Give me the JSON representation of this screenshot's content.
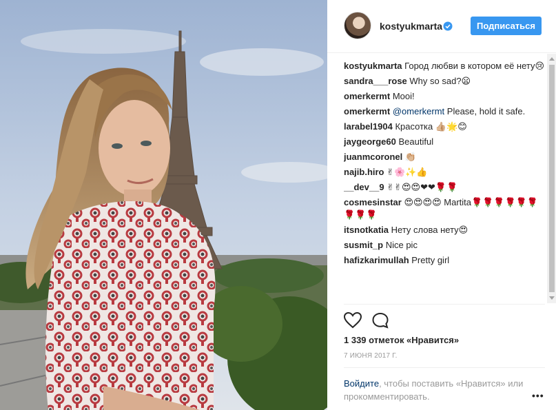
{
  "post": {
    "author": "kostyukmarta",
    "follow_label": "Подписаться",
    "likes": "1 339 отметок «Нравится»",
    "date": "7 июня 2017 г."
  },
  "comments": [
    {
      "author": "kostyukmarta",
      "text": "Город любви в котором её нету😢"
    },
    {
      "author": "sandra___rose",
      "text": "Why so sad?😦"
    },
    {
      "author": "omerkermt",
      "text": "Mooi!"
    },
    {
      "author": "omerkermt",
      "mention": "@omerkermt",
      "text": "Please, hold it safe."
    },
    {
      "author": "larabel1904",
      "text": "Красотка 👍🏼🌟😊"
    },
    {
      "author": "jaygeorge60",
      "text": "Beautiful"
    },
    {
      "author": "juanmcoronel",
      "text": "👏🏼"
    },
    {
      "author": "najib.hiro",
      "text": "✌🌸✨👍"
    },
    {
      "author": "__dev__9",
      "text": "✌✌😍😍❤❤🌹🌹"
    },
    {
      "author": "cosmesinstar",
      "text": "😍😍😍😍 Martita🌹🌹🌹🌹🌹🌹🌹🌹🌹"
    },
    {
      "author": "itsnotkatia",
      "text": "Нету слова нету😍"
    },
    {
      "author": "susmit_p",
      "text": "Nice pic"
    },
    {
      "author": "hafizkarimullah",
      "text": "Pretty girl"
    }
  ],
  "login_prompt": {
    "link": "Войдите",
    "text": ", чтобы поставить «Нравится» или прокомментировать."
  },
  "icons": {
    "verified": "verified-badge-icon",
    "like": "heart-icon",
    "comment": "comment-icon",
    "more": "more-options-icon"
  },
  "colors": {
    "accent": "#3897f0",
    "link": "#003569",
    "muted": "#999999"
  }
}
